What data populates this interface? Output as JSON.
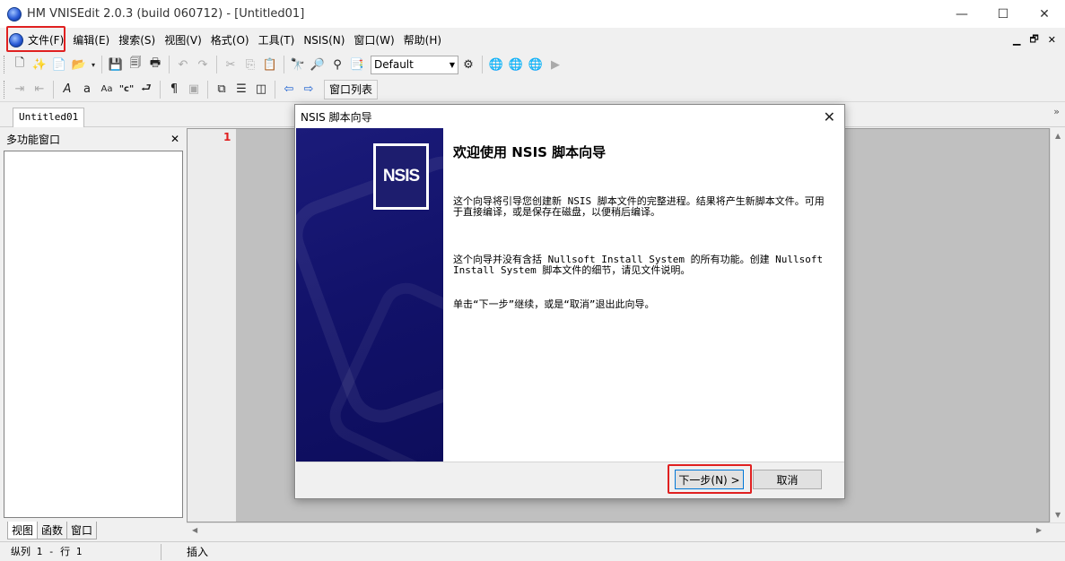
{
  "window": {
    "title": "HM VNISEdit 2.0.3 (build 060712) - [Untitled01]",
    "controls": [
      "—",
      "☐",
      "✕"
    ]
  },
  "menu": {
    "items": [
      "文件(F)",
      "编辑(E)",
      "搜索(S)",
      "视图(V)",
      "格式(O)",
      "工具(T)",
      "NSIS(N)",
      "窗口(W)",
      "帮助(H)"
    ],
    "mdi_controls": [
      "▁",
      "🗗",
      "✕"
    ]
  },
  "toolbar": {
    "combo_value": "Default",
    "window_list_label": "窗口列表"
  },
  "document_tabs": [
    "Untitled01"
  ],
  "left_panel": {
    "title": "多功能窗口",
    "tabs": [
      "视图",
      "函数",
      "窗口"
    ]
  },
  "editor": {
    "line_number": "1"
  },
  "status": {
    "position": "纵列 1 - 行 1",
    "mode": "插入"
  },
  "dialog": {
    "title": "NSIS 脚本向导",
    "logo_text": "NSIS",
    "heading": "欢迎使用 NSIS 脚本向导",
    "paragraph1": "这个向导将引导您创建新 NSIS 脚本文件的完整进程。结果将产生新脚本文件。可用于直接编译，或是保存在磁盘，以便稍后编译。",
    "paragraph2": "这个向导并没有含括 Nullsoft Install System 的所有功能。创建 Nullsoft Install System 脚本文件的细节，请见文件说明。",
    "paragraph3": "单击“下一步”继续，或是“取消”退出此向导。",
    "next_label": "下一步(N) >",
    "cancel_label": "取消"
  },
  "colors": {
    "highlight": "#e02020",
    "wizard_sidebar": "#12126a",
    "editor_bg": "#c0c0c0"
  }
}
